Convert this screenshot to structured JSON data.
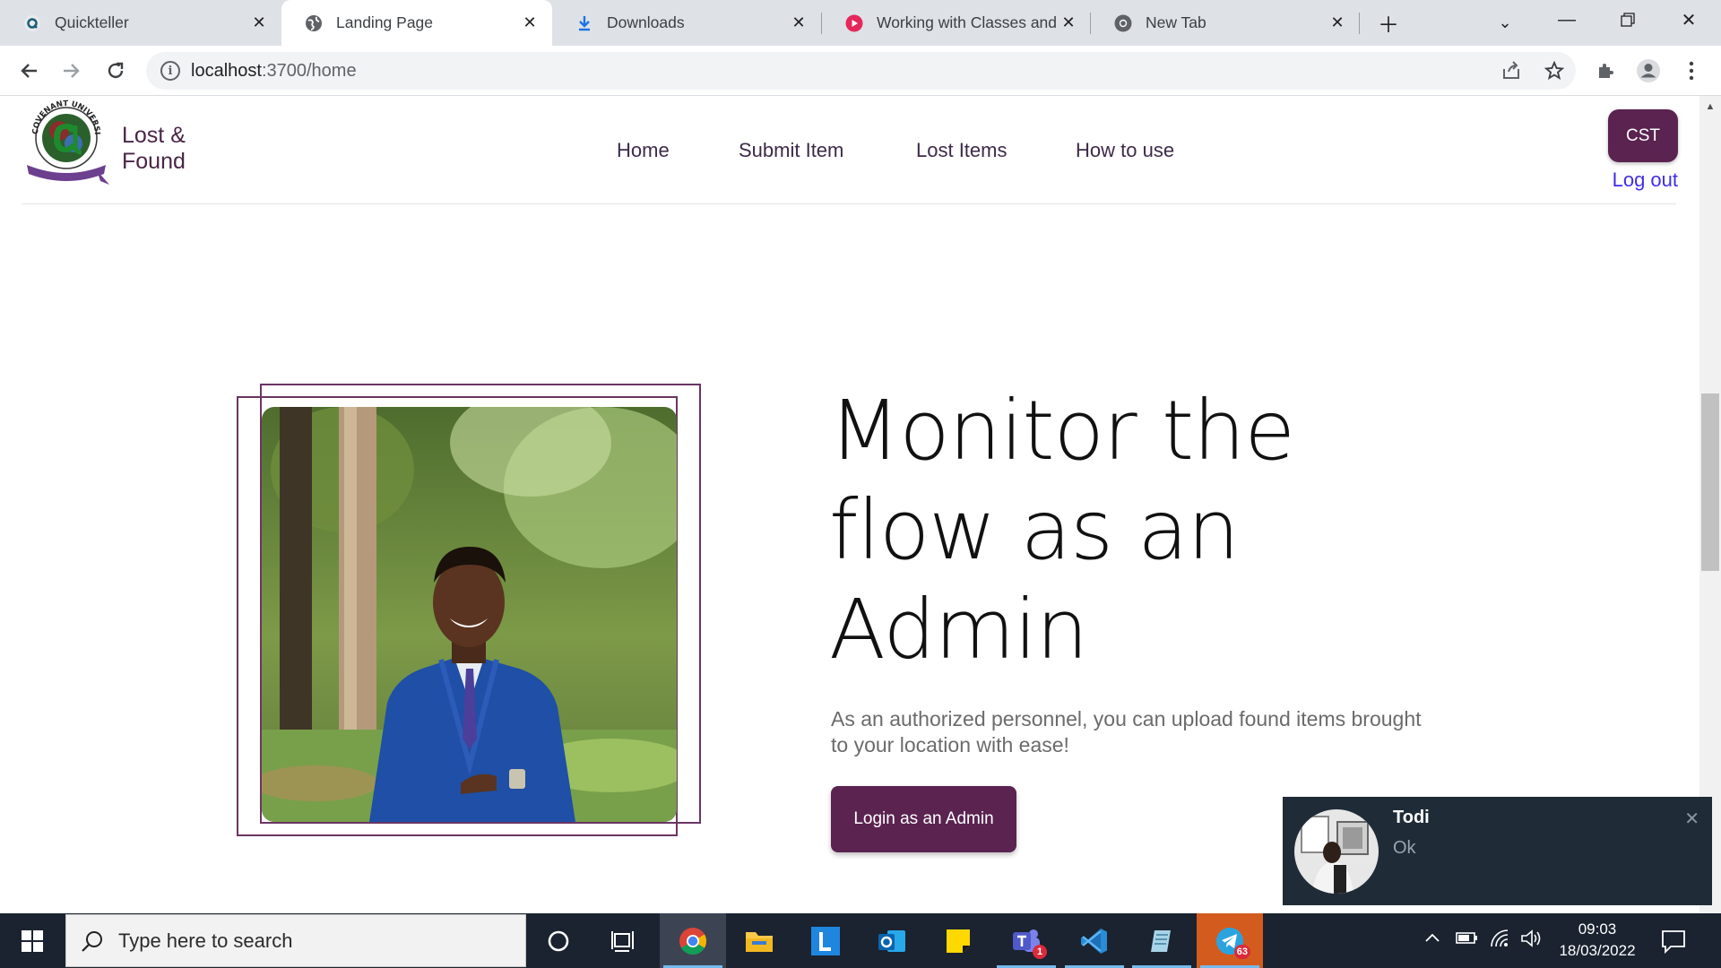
{
  "browser": {
    "tabs": [
      {
        "title": "Quickteller",
        "favicon": "quickteller-icon"
      },
      {
        "title": "Landing Page",
        "favicon": "globe-icon",
        "active": true
      },
      {
        "title": "Downloads",
        "favicon": "download-icon"
      },
      {
        "title": "Working with Classes and",
        "favicon": "video-icon"
      },
      {
        "title": "New Tab",
        "favicon": "chrome-icon"
      }
    ],
    "url_host": "localhost",
    "url_path": ":3700/home"
  },
  "site": {
    "brand_line1": "Lost &",
    "brand_line2": "Found",
    "logo_text": "COVENANT UNIVERSITY",
    "nav": [
      "Home",
      "Submit Item",
      "Lost Items",
      "How to use"
    ],
    "user_initials": "CST",
    "logout": "Log out"
  },
  "hero": {
    "headline_line1": "Monitor the",
    "headline_line2": "flow as an",
    "headline_line3": "Admin",
    "subtext": "As an authorized personnel, you can upload found items brought to your location with ease!",
    "cta": "Login as an Admin"
  },
  "notification": {
    "sender": "Todi",
    "message": "Ok"
  },
  "taskbar": {
    "search_placeholder": "Type here to search",
    "apps": [
      "cortana-icon",
      "task-view-icon",
      "chrome-icon",
      "file-explorer-icon",
      "l-app-icon",
      "outlook-icon",
      "sticky-notes-icon",
      "teams-icon",
      "vscode-icon",
      "notepad-icon",
      "telegram-icon"
    ],
    "teams_badge": "1",
    "telegram_badge": "63",
    "time": "09:03",
    "date": "18/03/2022"
  },
  "colors": {
    "brand_purple": "#5a2350",
    "toast_bg": "#1f2c38",
    "taskbar_bg": "#1b2330"
  }
}
